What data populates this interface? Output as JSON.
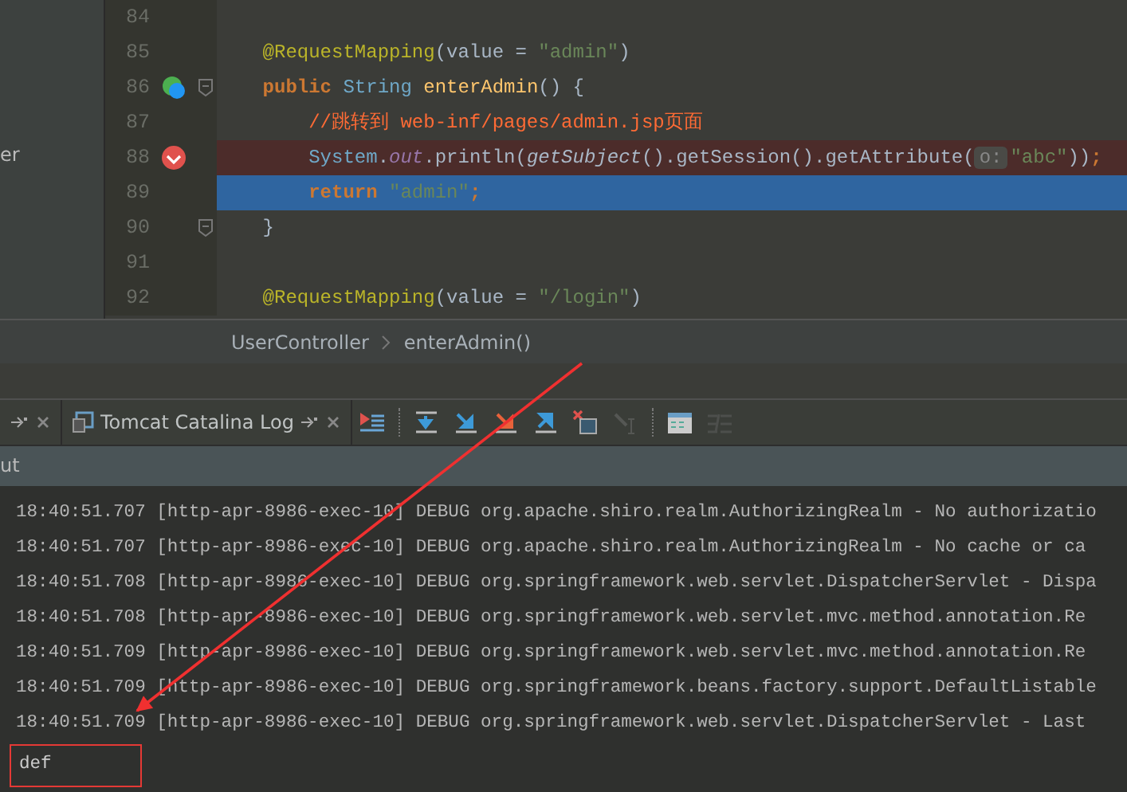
{
  "sidebar": {
    "items": [
      "er"
    ]
  },
  "editor": {
    "lines": [
      {
        "number": "84",
        "gutter_marker": false,
        "breakpoint": false,
        "execution_point": false,
        "fold": false
      },
      {
        "number": "85",
        "gutter_marker": false,
        "breakpoint": false,
        "execution_point": false,
        "fold": false,
        "tokens": [
          {
            "text": "    @RequestMapping",
            "kind": "annotation"
          },
          {
            "text": "(value = ",
            "kind": "plain"
          },
          {
            "text": "\"admin\"",
            "kind": "string"
          },
          {
            "text": ")",
            "kind": "plain"
          }
        ]
      },
      {
        "number": "86",
        "gutter_marker": true,
        "breakpoint": false,
        "execution_point": false,
        "fold": true,
        "tokens": [
          {
            "text": "    public ",
            "kind": "keyword"
          },
          {
            "text": "String ",
            "kind": "type"
          },
          {
            "text": "enterAdmin",
            "kind": "method"
          },
          {
            "text": "() {",
            "kind": "plain"
          }
        ]
      },
      {
        "number": "87",
        "gutter_marker": false,
        "breakpoint": false,
        "execution_point": false,
        "fold": false,
        "tokens": [
          {
            "text": "        //跳转到 web-inf/pages/admin.jsp页面",
            "kind": "comment"
          }
        ]
      },
      {
        "number": "88",
        "gutter_marker": false,
        "breakpoint": true,
        "execution_point": false,
        "fold": false,
        "tokens": [
          {
            "text": "        System",
            "kind": "type"
          },
          {
            "text": ".",
            "kind": "plain"
          },
          {
            "text": "out",
            "kind": "field"
          },
          {
            "text": ".println(",
            "kind": "plain"
          },
          {
            "text": "getSubject",
            "kind": "static"
          },
          {
            "text": "().getSession().getAttribute(",
            "kind": "plain"
          },
          {
            "text": "o:",
            "kind": "hint"
          },
          {
            "text": "\"abc\"",
            "kind": "string"
          },
          {
            "text": "))",
            "kind": "plain"
          },
          {
            "text": ";",
            "kind": "keyword"
          }
        ]
      },
      {
        "number": "89",
        "gutter_marker": false,
        "breakpoint": false,
        "execution_point": true,
        "fold": false,
        "tokens": [
          {
            "text": "        return ",
            "kind": "keyword"
          },
          {
            "text": "\"admin\"",
            "kind": "string"
          },
          {
            "text": ";",
            "kind": "keyword"
          }
        ]
      },
      {
        "number": "90",
        "gutter_marker": false,
        "breakpoint": false,
        "execution_point": false,
        "fold": true,
        "tokens": [
          {
            "text": "    }",
            "kind": "plain"
          }
        ]
      },
      {
        "number": "91",
        "gutter_marker": false,
        "breakpoint": false,
        "execution_point": false,
        "fold": false
      },
      {
        "number": "92",
        "gutter_marker": false,
        "breakpoint": false,
        "execution_point": false,
        "fold": false,
        "tokens": [
          {
            "text": "    @RequestMapping",
            "kind": "annotation"
          },
          {
            "text": "(value = ",
            "kind": "plain"
          },
          {
            "text": "\"/login\"",
            "kind": "string"
          },
          {
            "text": ")",
            "kind": "plain"
          }
        ]
      }
    ]
  },
  "breadcrumb": [
    "UserController",
    "enterAdmin()"
  ],
  "tool_window": {
    "tabs": [
      {
        "kind": "partial"
      },
      {
        "kind": "full",
        "label": "Tomcat Catalina Log"
      }
    ],
    "toolbar": [
      {
        "disabled": false
      },
      {
        "disabled": false
      },
      {
        "disabled": false
      },
      {
        "disabled": false
      },
      {
        "disabled": false
      },
      {
        "disabled": false
      },
      {
        "disabled": true
      },
      {
        "disabled": false
      },
      {
        "disabled": true
      }
    ],
    "header": "ut",
    "log": [
      "18:40:51.707 [http-apr-8986-exec-10] DEBUG org.apache.shiro.realm.AuthorizingRealm - No authorizatio",
      "18:40:51.707 [http-apr-8986-exec-10] DEBUG org.apache.shiro.realm.AuthorizingRealm - No cache or ca",
      "18:40:51.708 [http-apr-8986-exec-10] DEBUG org.springframework.web.servlet.DispatcherServlet - Dispa",
      "18:40:51.708 [http-apr-8986-exec-10] DEBUG org.springframework.web.servlet.mvc.method.annotation.Re",
      "18:40:51.709 [http-apr-8986-exec-10] DEBUG org.springframework.web.servlet.mvc.method.annotation.Re",
      "18:40:51.709 [http-apr-8986-exec-10] DEBUG org.springframework.beans.factory.support.DefaultListable",
      "18:40:51.709 [http-apr-8986-exec-10] DEBUG org.springframework.web.servlet.DispatcherServlet - Last"
    ],
    "output": "def"
  }
}
